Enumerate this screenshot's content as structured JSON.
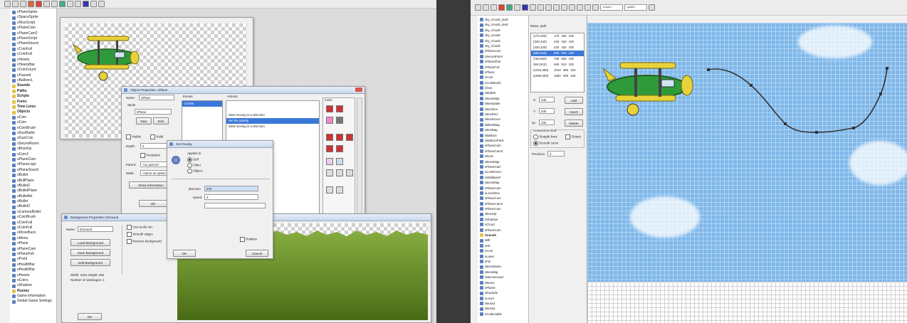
{
  "left_tree": {
    "items": [
      {
        "label": "cPlaneSprite",
        "type": "item"
      },
      {
        "label": "cSpaceSprite",
        "type": "item"
      },
      {
        "label": "cRiseScript",
        "type": "item"
      },
      {
        "label": "cPlaneCam",
        "type": "item"
      },
      {
        "label": "cPlaneCam2",
        "type": "item"
      },
      {
        "label": "cPlaneScript",
        "type": "item"
      },
      {
        "label": "cPlaneSound",
        "type": "item"
      },
      {
        "label": "cCoinFull",
        "type": "item"
      },
      {
        "label": "cCoinFull",
        "type": "item"
      },
      {
        "label": "cHearts",
        "type": "item"
      },
      {
        "label": "cHeartsBar",
        "type": "item"
      },
      {
        "label": "cCoinCount",
        "type": "item"
      },
      {
        "label": "cPaused",
        "type": "item"
      },
      {
        "label": "cBalloon1",
        "type": "item"
      },
      {
        "label": "Sounds",
        "type": "folder"
      },
      {
        "label": "Paths",
        "type": "folder"
      },
      {
        "label": "Scripts",
        "type": "folder"
      },
      {
        "label": "Fonts",
        "type": "folder"
      },
      {
        "label": "Time Lines",
        "type": "folder"
      },
      {
        "label": "Objects",
        "type": "folder"
      },
      {
        "label": "oCoin",
        "type": "item"
      },
      {
        "label": "oCoin",
        "type": "item"
      },
      {
        "label": "oCoinBrush",
        "type": "item"
      },
      {
        "label": "oGunBullet",
        "type": "item"
      },
      {
        "label": "oGunCoin",
        "type": "item"
      },
      {
        "label": "oSecretRoom",
        "type": "item"
      },
      {
        "label": "oBossUp",
        "type": "item"
      },
      {
        "label": "oCoin2",
        "type": "item"
      },
      {
        "label": "oPlaneCam",
        "type": "item"
      },
      {
        "label": "oPlaneLogo",
        "type": "item"
      },
      {
        "label": "oPlaneSound",
        "type": "item"
      },
      {
        "label": "oBullet",
        "type": "item"
      },
      {
        "label": "oBullPlane",
        "type": "item"
      },
      {
        "label": "oBullet2",
        "type": "item"
      },
      {
        "label": "oBulletPlane",
        "type": "item"
      },
      {
        "label": "oBulletAir",
        "type": "item"
      },
      {
        "label": "oBullet",
        "type": "item"
      },
      {
        "label": "oBullet2",
        "type": "item"
      },
      {
        "label": "oCameraBullet",
        "type": "item"
      },
      {
        "label": "oCoinBrush",
        "type": "item"
      },
      {
        "label": "oCoinFull",
        "type": "item"
      },
      {
        "label": "oCoinFull",
        "type": "item"
      },
      {
        "label": "oMoveBack",
        "type": "item"
      },
      {
        "label": "oMenu",
        "type": "item"
      },
      {
        "label": "oPlane",
        "type": "item"
      },
      {
        "label": "oPlaneCam",
        "type": "item"
      },
      {
        "label": "oPlaneFull",
        "type": "item"
      },
      {
        "label": "oPoint",
        "type": "item"
      },
      {
        "label": "oHealthBar",
        "type": "item"
      },
      {
        "label": "oHealthBar",
        "type": "item"
      },
      {
        "label": "oHearts",
        "type": "item"
      },
      {
        "label": "oCoins",
        "type": "item"
      },
      {
        "label": "oShadow",
        "type": "item"
      },
      {
        "label": "Rooms",
        "type": "folder"
      },
      {
        "label": "Game Information",
        "type": "item"
      },
      {
        "label": "Global Game Settings",
        "type": "item"
      }
    ]
  },
  "sprite_properties": {
    "title": "Object Properties: oPlane",
    "name_label": "Name:",
    "name_value": "oPlane",
    "sprite_label": "Sprite",
    "sprite_value": "sPlane",
    "new_button": "New",
    "edit_button": "Edit",
    "visible_label": "Visible",
    "solid_label": "Solid",
    "depth_label": "Depth:",
    "depth_value": "0",
    "persistent_label": "Persistent",
    "parent_label": "Parent:",
    "parent_value": "<no parent>",
    "mask_label": "Mask:",
    "mask_value": "<same as sprite>",
    "show_info_button": "Show Information",
    "ok_button": "OK",
    "events_header": "Events:",
    "events": [
      "Create"
    ],
    "actions_header": "Actions:",
    "actions": [
      "Start moving in a direction",
      "Set the gravity",
      "Start moving in a direction"
    ],
    "tab_labels": [
      "move",
      "main1",
      "main2",
      "control",
      "score",
      "extra",
      "draw"
    ]
  },
  "dialog": {
    "title": "Set Gravity",
    "applies_to": "Applies to",
    "opt_self": "Self",
    "opt_other": "Other",
    "opt_object": "Object:",
    "direction_label": "direction:",
    "direction_value": "270",
    "speed_label": "speed:",
    "speed_value": "0",
    "relative_label": "Relative",
    "ok_button": "OK",
    "cancel_button": "Cancel"
  },
  "bg_properties": {
    "title": "Background Properties: bGround",
    "name_label": "Name:",
    "name_value": "bGround",
    "load_button": "Load Background",
    "save_button": "Save Background",
    "edit_button": "Edit Background",
    "info_text": "Width: 1024 Height: 256",
    "info_text2": "Number of subimages: 1",
    "tileset_label": "Use as tile set",
    "smooth_label": "Smooth edges",
    "transparent_label": "Remove background",
    "ok_button": "OK"
  },
  "right_tree": {
    "items": [
      "sky_clouds_land",
      "sky_clouds_land",
      "sky_clouds",
      "sky_clouds",
      "sky_clouds",
      "sky_clouds",
      "sPlaneCam",
      "sSecretPoint",
      "sPlaneShot",
      "sPlaneFull",
      "sPlane",
      "sCoin",
      "sCoinBrush",
      "sGun",
      "sBullets",
      "sBossMap",
      "sBaseplate",
      "sBoxOne",
      "sBoxRed",
      "sBoxGreen",
      "sBlackBag",
      "sBoxBag",
      "sBalloon",
      "sBalloonPack",
      "sPlaneCam",
      "sPlaneCam2",
      "sBoss",
      "sBossMap",
      "sPlaneCam",
      "sCoinRoom",
      "sWallbaseF",
      "sBossMap",
      "sPlaneCam",
      "sLevelOne",
      "sPlaneCom",
      "sPlaneCam2",
      "sPlaneCam",
      "sBoxSpt",
      "sShadow",
      "sCloud",
      "sPlaneCam",
      "Sounds",
      "sBlt",
      "sHit",
      "sCoin",
      "sLaser",
      "sFly",
      "sBossMusic",
      "sBossBig",
      "sMenuSound",
      "sBoom",
      "sPlanet",
      "sExplode",
      "sLevel",
      "sBoss3",
      "sBoss4",
      "sCollectable"
    ]
  },
  "path_editor": {
    "tabs": [
      "Name",
      "path"
    ],
    "columns": [
      "point",
      "x",
      "y",
      "sp"
    ],
    "points": [
      {
        "label": "(170,200)",
        "x": "170",
        "y": "200",
        "sp": "100"
      },
      {
        "label": "(340,340)",
        "x": "340",
        "y": "340",
        "sp": "100"
      },
      {
        "label": "(420,420)",
        "x": "420",
        "y": "420",
        "sp": "100"
      },
      {
        "label": "(560,540)",
        "x": "560",
        "y": "540",
        "sp": "100"
      },
      {
        "label": "(760,560)",
        "x": "760",
        "y": "560",
        "sp": "100"
      },
      {
        "label": "(940,510)",
        "x": "940",
        "y": "510",
        "sp": "100"
      },
      {
        "label": "(1010,380)",
        "x": "1010",
        "y": "380",
        "sp": "100"
      },
      {
        "label": "(1060,300)",
        "x": "1060",
        "y": "300",
        "sp": "100"
      }
    ],
    "x_label": "X:",
    "x_value": "340",
    "y_label": "Y:",
    "y_value": "340",
    "sp_label": "sp:",
    "sp_value": "100",
    "add_button": "Add",
    "insert_button": "Insert",
    "delete_button": "Delete",
    "connection_label": "Connection Kind",
    "straight_label": "Straight lines",
    "closed_label": "Closed",
    "smooth_label": "Smooth curve",
    "precision_label": "Precision",
    "precision_value": "4",
    "room_dropdown": "<room>",
    "snap_dropdown": "<path>"
  },
  "colors": {
    "divider": "#3a3a3a",
    "sky": "#7fb8ea",
    "selection": "#3b78d8",
    "grass": "#5f8a22"
  }
}
